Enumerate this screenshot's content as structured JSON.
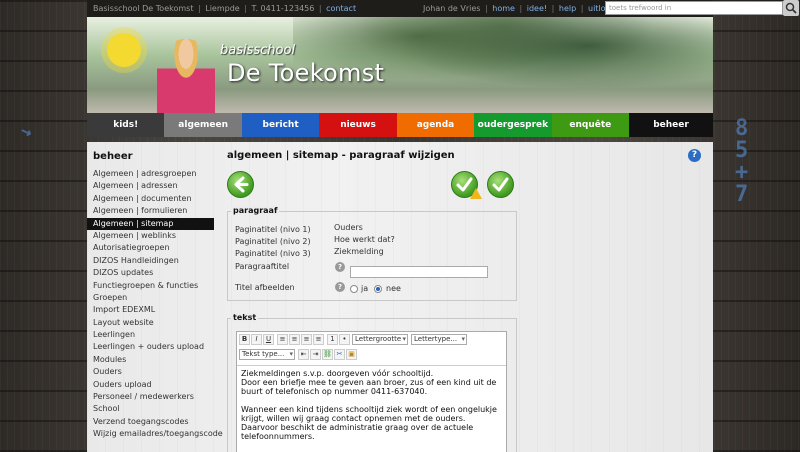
{
  "topbar": {
    "school": "Basisschool De Toekomst",
    "place": "Liempde",
    "phone": "T. 0411-123456",
    "contact": "contact",
    "user": "Johan de Vries",
    "links": [
      "home",
      "idee!",
      "help",
      "uitloggen"
    ],
    "search_placeholder": "toets trefwoord in"
  },
  "header": {
    "subtitle": "basisschool",
    "title": "De Toekomst"
  },
  "nav": [
    {
      "label": "kids!",
      "color": "#3a3a3a"
    },
    {
      "label": "algemeen",
      "color": "#7a7a7a"
    },
    {
      "label": "bericht",
      "color": "#1f5fc4"
    },
    {
      "label": "nieuws",
      "color": "#d41010"
    },
    {
      "label": "agenda",
      "color": "#f06c00"
    },
    {
      "label": "oudergesprek",
      "color": "#159a2e"
    },
    {
      "label": "enquête",
      "color": "#3d9a12"
    },
    {
      "label": "beheer",
      "color": "#111111"
    }
  ],
  "sidebar": {
    "title": "beheer",
    "items": [
      "Algemeen | adresgroepen",
      "Algemeen | adressen",
      "Algemeen | documenten",
      "Algemeen | formulieren",
      "Algemeen | sitemap",
      "Algemeen | weblinks",
      "Autorisatiegroepen",
      "DIZOS Handleidingen",
      "DIZOS updates",
      "Functiegroepen & functies",
      "Groepen",
      "Import EDEXML",
      "Layout website",
      "Leerlingen",
      "Leerlingen + ouders upload",
      "Modules",
      "Ouders",
      "Ouders upload",
      "Personeel / medewerkers",
      "School",
      "Verzend toegangscodes",
      "Wijzig emailadres/toegangscode"
    ],
    "active_index": 4
  },
  "content": {
    "heading": "algemeen | sitemap - paragraaf wijzigen",
    "paragraaf": {
      "legend": "paragraaf",
      "fields": [
        {
          "label": "Paginatitel (nivo 1)",
          "value": "Ouders"
        },
        {
          "label": "Paginatitel (nivo 2)",
          "value": "Hoe werkt dat?"
        },
        {
          "label": "Paginatitel (nivo 3)",
          "value": "Ziekmelding"
        }
      ],
      "paragraaftitel_label": "Paragraaftitel",
      "titel_afbeelden_label": "Titel afbeelden",
      "radio_ja": "ja",
      "radio_nee": "nee"
    },
    "tekst": {
      "legend": "tekst",
      "toolbar": {
        "font_size": "Lettergrootte",
        "font_type": "Lettertype...",
        "text_type": "Tekst type..."
      },
      "body": [
        "Ziekmeldingen s.v.p. doorgeven vóór schooltijd.",
        "Door een briefje mee te geven aan broer, zus of een kind uit de buurt of telefonisch op nummer 0411-637040.",
        "Wanneer een kind tijdens schooltijd ziek wordt of een ongelukje krijgt, willen wij graag contact opnemen met de ouders. Daarvoor beschikt de administratie graag over de actuele telefoonnummers."
      ]
    }
  }
}
